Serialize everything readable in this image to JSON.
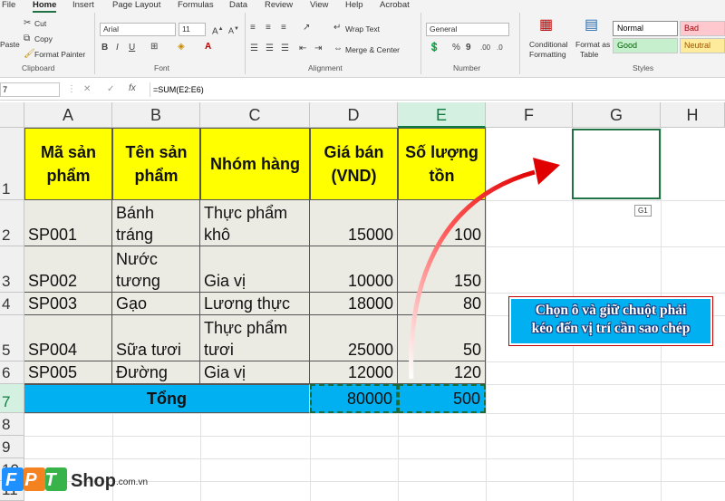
{
  "ribbon": {
    "tabs": [
      "File",
      "Home",
      "Insert",
      "Page Layout",
      "Formulas",
      "Data",
      "Review",
      "View",
      "Help",
      "Acrobat"
    ],
    "clipboard": {
      "paste": "Paste",
      "cut": "Cut",
      "copy": "Copy",
      "format_painter": "Format Painter",
      "group": "Clipboard"
    },
    "font": {
      "name": "Arial",
      "size": "11",
      "group": "Font"
    },
    "alignment": {
      "wrap_text": "Wrap Text",
      "merge_center": "Merge & Center",
      "group": "Alignment"
    },
    "number": {
      "format": "General",
      "group": "Number"
    },
    "styles": {
      "conditional": "Conditional",
      "conditional2": "Formatting",
      "format_as": "Format as",
      "format_as2": "Table",
      "normal": "Normal",
      "bad": "Bad",
      "good": "Good",
      "neutral": "Neutral",
      "group": "Styles"
    }
  },
  "formula_bar": {
    "name_box": "7",
    "formula": "=SUM(E2:E6)"
  },
  "columns": [
    "A",
    "B",
    "C",
    "D",
    "E",
    "F",
    "G",
    "H"
  ],
  "rows": [
    "1",
    "2",
    "3",
    "4",
    "5",
    "6",
    "7",
    "8",
    "9",
    "10",
    "11"
  ],
  "table": {
    "headers": [
      [
        "Mã sản",
        "phẩm"
      ],
      [
        "Tên sản",
        "phẩm"
      ],
      [
        "Nhóm hàng"
      ],
      [
        "Giá bán",
        "(VND)"
      ],
      [
        "Số lượng",
        "tồn"
      ]
    ],
    "rows": [
      {
        "a": "SP001",
        "b": [
          "Bánh",
          "tráng"
        ],
        "c": [
          "Thực phẩm",
          "khô"
        ],
        "d": "15000",
        "e": "100"
      },
      {
        "a": "SP002",
        "b": [
          "Nước",
          "tương"
        ],
        "c": [
          "Gia vị"
        ],
        "d": "10000",
        "e": "150"
      },
      {
        "a": "SP003",
        "b": [
          "Gạo"
        ],
        "c": [
          "Lương thực"
        ],
        "d": "18000",
        "e": "80"
      },
      {
        "a": "SP004",
        "b": [
          "Sữa tươi"
        ],
        "c": [
          "Thực phẩm",
          "tươi"
        ],
        "d": "25000",
        "e": "50"
      },
      {
        "a": "SP005",
        "b": [
          "Đường"
        ],
        "c": [
          "Gia vị"
        ],
        "d": "12000",
        "e": "120"
      }
    ],
    "total": {
      "label": "Tổng",
      "d": "80000",
      "e": "500"
    }
  },
  "drag_tooltip": "G1",
  "callout": [
    "Chọn ô và giữ chuột phải",
    "kéo đến vị trí cần sao chép"
  ],
  "watermark": {
    "brand": "FPT",
    "shop": "Shop",
    "domain": ".com.vn"
  },
  "colors": {
    "header_fill": "#ffff00",
    "total_fill": "#00b0f0",
    "data_fill": "#ecebe3",
    "arrow": "#e00000",
    "accent": "#107c41"
  }
}
